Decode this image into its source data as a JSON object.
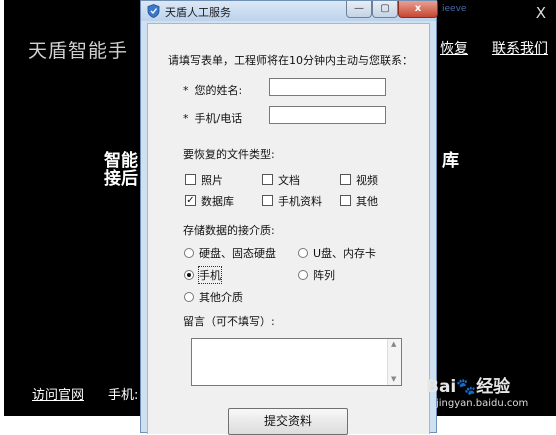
{
  "window": {
    "title": "天盾人工服务",
    "min_glyph": "—",
    "max_glyph": "▢",
    "close_glyph": "x"
  },
  "form": {
    "intro": "请填写表单，工程师将在10分钟内主动与您联系：",
    "required_mark": "*",
    "name_label": "您的姓名:",
    "name_value": "",
    "phone_label": "手机/电话",
    "phone_value": "",
    "file_types_label": "要恢复的文件类型:",
    "file_types": [
      {
        "label": "照片",
        "checked": false
      },
      {
        "label": "文档",
        "checked": false
      },
      {
        "label": "视频",
        "checked": false
      },
      {
        "label": "数据库",
        "checked": true
      },
      {
        "label": "手机资料",
        "checked": false
      },
      {
        "label": "其他",
        "checked": false
      }
    ],
    "media_label": "存储数据的接介质:",
    "media": [
      {
        "label": "硬盘、固态硬盘",
        "selected": false
      },
      {
        "label": "U盘、内存卡",
        "selected": false
      },
      {
        "label": "手机",
        "selected": true
      },
      {
        "label": "阵列",
        "selected": false
      },
      {
        "label": "其他介质",
        "selected": false
      }
    ],
    "comment_label": "留言（可不填写）:",
    "comment_value": "",
    "submit_label": "提交资料"
  },
  "background_app": {
    "title": "天盾智能手",
    "close": "X",
    "top_right_link": "ieeve",
    "nav_recover": "恢复",
    "nav_contact": "联系我们",
    "heading_line1": "智能",
    "heading_line2": "接后",
    "heading_right": "库",
    "footer_link": "访问官网",
    "footer_phone": "手机:"
  },
  "watermark": {
    "logo_text": "Bai",
    "logo_paw": "🐾",
    "logo_suffix": "经验",
    "url": "jingyan.baidu.com"
  },
  "colors": {
    "window_frame": "#cfe0f2",
    "close_button": "#c74731",
    "background_app": "#000000"
  }
}
